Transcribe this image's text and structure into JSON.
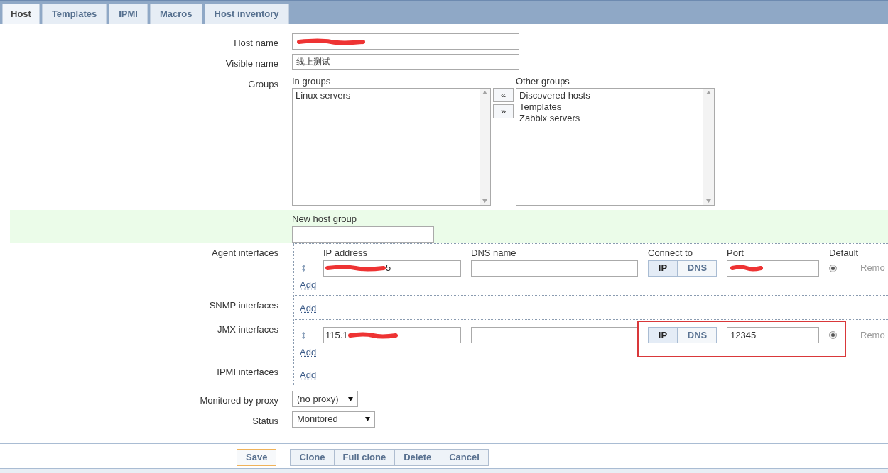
{
  "tabs": [
    {
      "label": "Host",
      "selected": true
    },
    {
      "label": "Templates",
      "selected": false
    },
    {
      "label": "IPMI",
      "selected": false
    },
    {
      "label": "Macros",
      "selected": false
    },
    {
      "label": "Host inventory",
      "selected": false
    }
  ],
  "host_name": {
    "label": "Host name",
    "redacted": true
  },
  "visible_name": {
    "label": "Visible name",
    "value": "线上测试"
  },
  "groups": {
    "label": "Groups",
    "in_groups_label": "In groups",
    "in_groups": [
      "Linux servers"
    ],
    "other_groups_label": "Other groups",
    "other_groups": [
      "Discovered hosts",
      "Templates",
      "Zabbix servers"
    ],
    "move_left": "«",
    "move_right": "»"
  },
  "new_host_group": {
    "label": "New host group"
  },
  "interfaces": {
    "headers": [
      "IP address",
      "DNS name",
      "Connect to",
      "Port",
      "Default"
    ],
    "sections": [
      {
        "label": "Agent interfaces",
        "add": "Add",
        "rows": [
          {
            "ip": "5",
            "ip_redacted_first": true,
            "port_redacted": true,
            "connect": [
              {
                "label": "IP",
                "selected": true
              },
              {
                "label": "DNS",
                "selected": false
              }
            ],
            "default": true,
            "remove": "Remo",
            "highlighted": false
          }
        ]
      },
      {
        "label": "SNMP interfaces",
        "add": "Add"
      },
      {
        "label": "JMX interfaces",
        "add": "Add",
        "rows": [
          {
            "ip": "115.1",
            "ip_redacted_first": false,
            "port": "12345",
            "connect": [
              {
                "label": "IP",
                "selected": true
              },
              {
                "label": "DNS",
                "selected": false
              }
            ],
            "default": true,
            "remove": "Remo",
            "highlighted": true
          }
        ]
      },
      {
        "label": "IPMI interfaces",
        "add": "Add"
      }
    ]
  },
  "proxy": {
    "label": "Monitored by proxy",
    "value": "(no proxy)"
  },
  "status": {
    "label": "Status",
    "value": "Monitored"
  },
  "buttons": [
    {
      "label": "Save",
      "kind": "primary"
    },
    {
      "label": "Clone",
      "kind": "group"
    },
    {
      "label": "Full clone",
      "kind": "group"
    },
    {
      "label": "Delete",
      "kind": "group"
    },
    {
      "label": "Cancel",
      "kind": "group"
    }
  ]
}
